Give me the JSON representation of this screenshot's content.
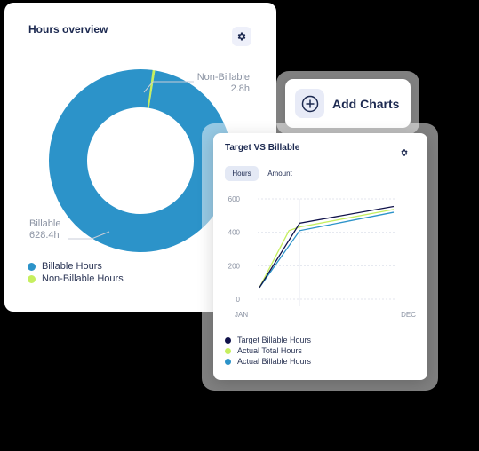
{
  "hours_overview": {
    "title": "Hours overview",
    "slices": [
      {
        "name": "Billable",
        "value": 628.4,
        "label_name": "Billable",
        "label_value": "628.4h",
        "color": "#2c93c9"
      },
      {
        "name": "Non-Billable",
        "value": 2.8,
        "label_name": "Non-Billable",
        "label_value": "2.8h",
        "color": "#c6ef5f"
      }
    ],
    "legend": [
      {
        "label": "Billable Hours",
        "color": "#2c93c9"
      },
      {
        "label": "Non-Billable Hours",
        "color": "#c6ef5f"
      }
    ]
  },
  "add_charts": {
    "label": "Add Charts",
    "icon": "plus-circle-icon"
  },
  "target_vs_billable": {
    "title": "Target VS Billable",
    "tabs": [
      {
        "label": "Hours",
        "active": true
      },
      {
        "label": "Amount",
        "active": false
      }
    ],
    "legend": [
      {
        "label": "Target Billable Hours",
        "color": "#10124a"
      },
      {
        "label": "Actual Total Hours",
        "color": "#c6ef5f"
      },
      {
        "label": "Actual Billable Hours",
        "color": "#2c93c9"
      }
    ]
  },
  "chart_data": {
    "type": "line",
    "title": "Target VS Billable",
    "x_tick_labels": [
      "JAN",
      "DEC"
    ],
    "y_ticks": [
      0,
      200,
      400,
      600
    ],
    "ylim": [
      0,
      600
    ],
    "grid": true,
    "series": [
      {
        "name": "Target Billable Hours",
        "color": "#10124a",
        "points": [
          [
            0,
            70
          ],
          [
            0.3,
            455
          ],
          [
            1,
            555
          ]
        ]
      },
      {
        "name": "Actual Total Hours",
        "color": "#c6ef5f",
        "points": [
          [
            0,
            70
          ],
          [
            0.22,
            410
          ],
          [
            0.3,
            432
          ],
          [
            1,
            537
          ]
        ]
      },
      {
        "name": "Actual Billable Hours",
        "color": "#2c93c9",
        "points": [
          [
            0,
            70
          ],
          [
            0.3,
            410
          ],
          [
            1,
            520
          ]
        ]
      }
    ]
  }
}
